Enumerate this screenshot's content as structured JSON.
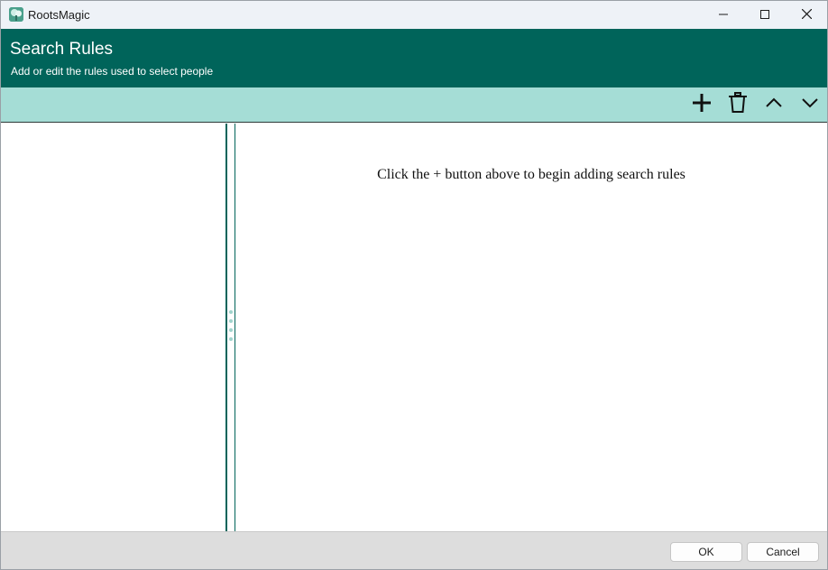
{
  "window": {
    "app_title": "RootsMagic",
    "icons": {
      "app": "tree-app-icon",
      "minimize": "minimize-icon",
      "maximize": "maximize-icon",
      "close": "close-icon"
    }
  },
  "header": {
    "title": "Search Rules",
    "subtitle": "Add or edit the rules used to select people"
  },
  "toolbar": {
    "icons": [
      "plus-icon",
      "trash-icon",
      "chevron-up-icon",
      "chevron-down-icon"
    ]
  },
  "main": {
    "hint": "Click the + button above to begin adding search rules"
  },
  "footer": {
    "ok_label": "OK",
    "cancel_label": "Cancel"
  },
  "colors": {
    "header_bg": "#00645a",
    "toolbar_bg": "#a5ddd6",
    "titlebar_bg": "#eef2f7",
    "footer_bg": "#dddddd"
  }
}
